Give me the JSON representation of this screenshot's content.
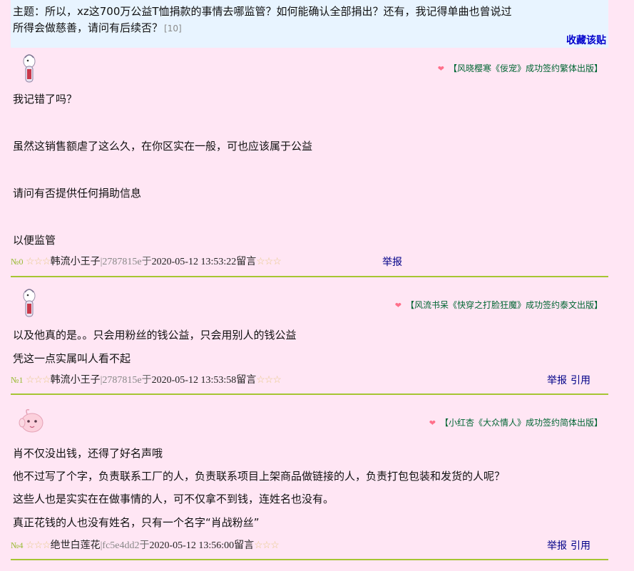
{
  "topic": {
    "line1": "主题：所以，xz这700万公益T恤捐款的事情去哪监管？如何能确认全部捐出？还有，我记得单曲也曾说过",
    "line2": "所得会做慈善，请问有后续否？",
    "count": "[10]",
    "favorite_label": "收藏该贴"
  },
  "posts": [
    {
      "ad": "【风晓樱寒《佞宠》成功签约繁体出版】",
      "lines": [
        "我记错了吗？",
        "虽然这销售额虐了这么久，在你区实在一般，可也应该属于公益",
        "请问有否提供任何捐助信息",
        "以便监管"
      ],
      "floor": "№0",
      "stars_left": "☆☆☆",
      "author": "韩流小王子",
      "uid": "|2787815e",
      "yu": "于",
      "datetime": "2020-05-12 13:53:22",
      "liuyan": "留言",
      "stars_right": "☆☆☆",
      "report": "举报",
      "quote": ""
    },
    {
      "ad": "【风流书呆《快穿之打脸狂魔》成功签约泰文出版】",
      "lines": [
        "以及他真的是。。只会用粉丝的钱公益，只会用别人的钱公益",
        "凭这一点实属叫人看不起"
      ],
      "floor": "№1",
      "stars_left": "☆☆☆",
      "author": "韩流小王子",
      "uid": "|2787815e",
      "yu": "于",
      "datetime": "2020-05-12 13:53:58",
      "liuyan": "留言",
      "stars_right": "☆☆☆",
      "report": "举报",
      "quote": "引用"
    },
    {
      "ad": "【小红杏《大众情人》成功签约简体出版】",
      "lines": [
        "肖不仅没出钱，还得了好名声哦",
        "他不过写了个字，负责联系工厂的人，负责联系项目上架商品做链接的人，负责打包包装和发货的人呢？",
        "这些人也是实实在在做事情的人，可不仅拿不到钱，连姓名也没有。",
        "真正花钱的人也没有姓名，只有一个名字“肖战粉丝”"
      ],
      "floor": "№4",
      "stars_left": "☆☆☆",
      "author": "绝世白莲花",
      "uid": "|fc5e4dd2",
      "yu": "于",
      "datetime": "2020-05-12 13:56:00",
      "liuyan": "留言",
      "stars_right": "☆☆☆",
      "report": "举报",
      "quote": "引用"
    }
  ],
  "colors": {
    "background": "#ffe6f4",
    "topic_bg": "#e8f4ff",
    "separator": "#a6c533",
    "link": "#000088",
    "ad_text": "#006633"
  },
  "icons": [
    "heart-icon",
    "avatar-bird-icon",
    "avatar-pink-blob-icon"
  ]
}
